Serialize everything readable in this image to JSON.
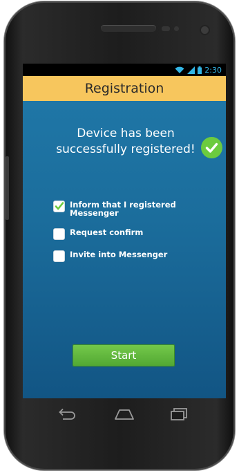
{
  "status_bar": {
    "time": "2:30",
    "icons": [
      "wifi-icon",
      "signal-icon",
      "battery-icon"
    ]
  },
  "app_bar": {
    "title": "Registration"
  },
  "success": {
    "message": "Device has been successfully registered!",
    "icon": "check-circle-icon"
  },
  "options": [
    {
      "label": "Inform that I registered Messenger",
      "checked": true
    },
    {
      "label": "Request confirm",
      "checked": false
    },
    {
      "label": "Invite into Messenger",
      "checked": false
    }
  ],
  "start_button": {
    "label": "Start"
  },
  "navigation": {
    "icons": [
      "back-icon",
      "home-icon",
      "recent-apps-icon"
    ]
  },
  "colors": {
    "title_bar": "#f7c65d",
    "content_background": "#1b6d9c",
    "success_check": "#6ccb3f",
    "start_button": "#5fb43a",
    "status_time": "#33b5e5"
  }
}
